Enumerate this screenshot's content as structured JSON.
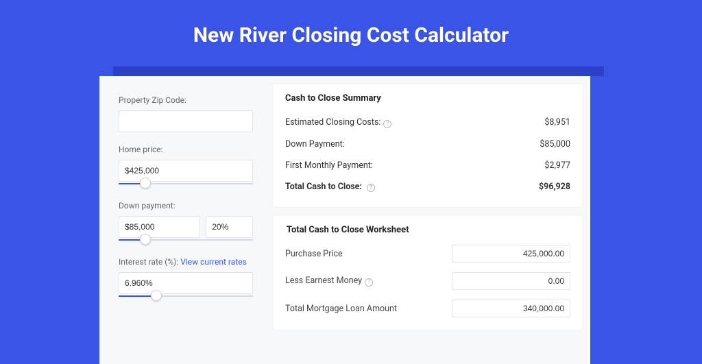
{
  "title": "New River Closing Cost Calculator",
  "left": {
    "zip_label": "Property Zip Code:",
    "zip_value": "",
    "home_price_label": "Home price:",
    "home_price_value": "$425,000",
    "home_price_slider_pct": 20,
    "down_payment_label": "Down payment:",
    "down_payment_value": "$85,000",
    "down_payment_pct": "20%",
    "down_payment_slider_pct": 20,
    "interest_label": "Interest rate (%): ",
    "interest_link": "View current rates",
    "interest_value": "6.960%",
    "interest_slider_pct": 28
  },
  "summary": {
    "heading": "Cash to Close Summary",
    "rows": [
      {
        "label": "Estimated Closing Costs:",
        "help": true,
        "value": "$8,951"
      },
      {
        "label": "Down Payment:",
        "help": false,
        "value": "$85,000"
      },
      {
        "label": "First Monthly Payment:",
        "help": false,
        "value": "$2,977"
      }
    ],
    "total": {
      "label": "Total Cash to Close:",
      "help": true,
      "value": "$96,928"
    }
  },
  "worksheet": {
    "heading": "Total Cash to Close Worksheet",
    "rows": [
      {
        "label": "Purchase Price",
        "help": false,
        "value": "425,000.00"
      },
      {
        "label": "Less Earnest Money",
        "help": true,
        "value": "0.00"
      },
      {
        "label": "Total Mortgage Loan Amount",
        "help": false,
        "value": "340,000.00"
      }
    ]
  }
}
